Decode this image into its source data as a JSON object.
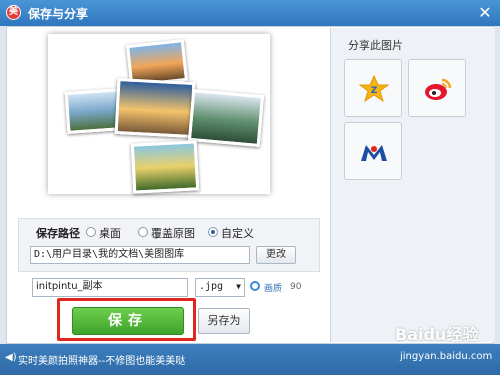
{
  "window": {
    "title": "保存与分享",
    "close_glyph": "✕",
    "logo_glyph": "美"
  },
  "share": {
    "title": "分享此图片",
    "targets": [
      "qq-zone-icon",
      "weibo-icon",
      "renren-icon"
    ]
  },
  "save_path": {
    "label": "保存路径",
    "options": [
      {
        "label": "桌面",
        "selected": false
      },
      {
        "label": "覆盖原图",
        "selected": false
      },
      {
        "label": "自定义",
        "selected": true
      }
    ],
    "path_value": "D:\\用户目录\\我的文档\\美图图库",
    "change_button": "更改"
  },
  "file": {
    "name_value": "initpintu_副本",
    "format_value": ".jpg",
    "quality_label": "画质",
    "quality_value": "90"
  },
  "buttons": {
    "save": "保存",
    "save_as": "另存为"
  },
  "status": {
    "text": "实时美颜拍照神器--不修图也能美美哒"
  },
  "watermark": {
    "brand": "Baidu经验",
    "url": "jingyan.baidu.com"
  },
  "colors": {
    "title_bar": "#2f77be",
    "save_green": "#3ea32a",
    "highlight_red": "#e0261f"
  }
}
